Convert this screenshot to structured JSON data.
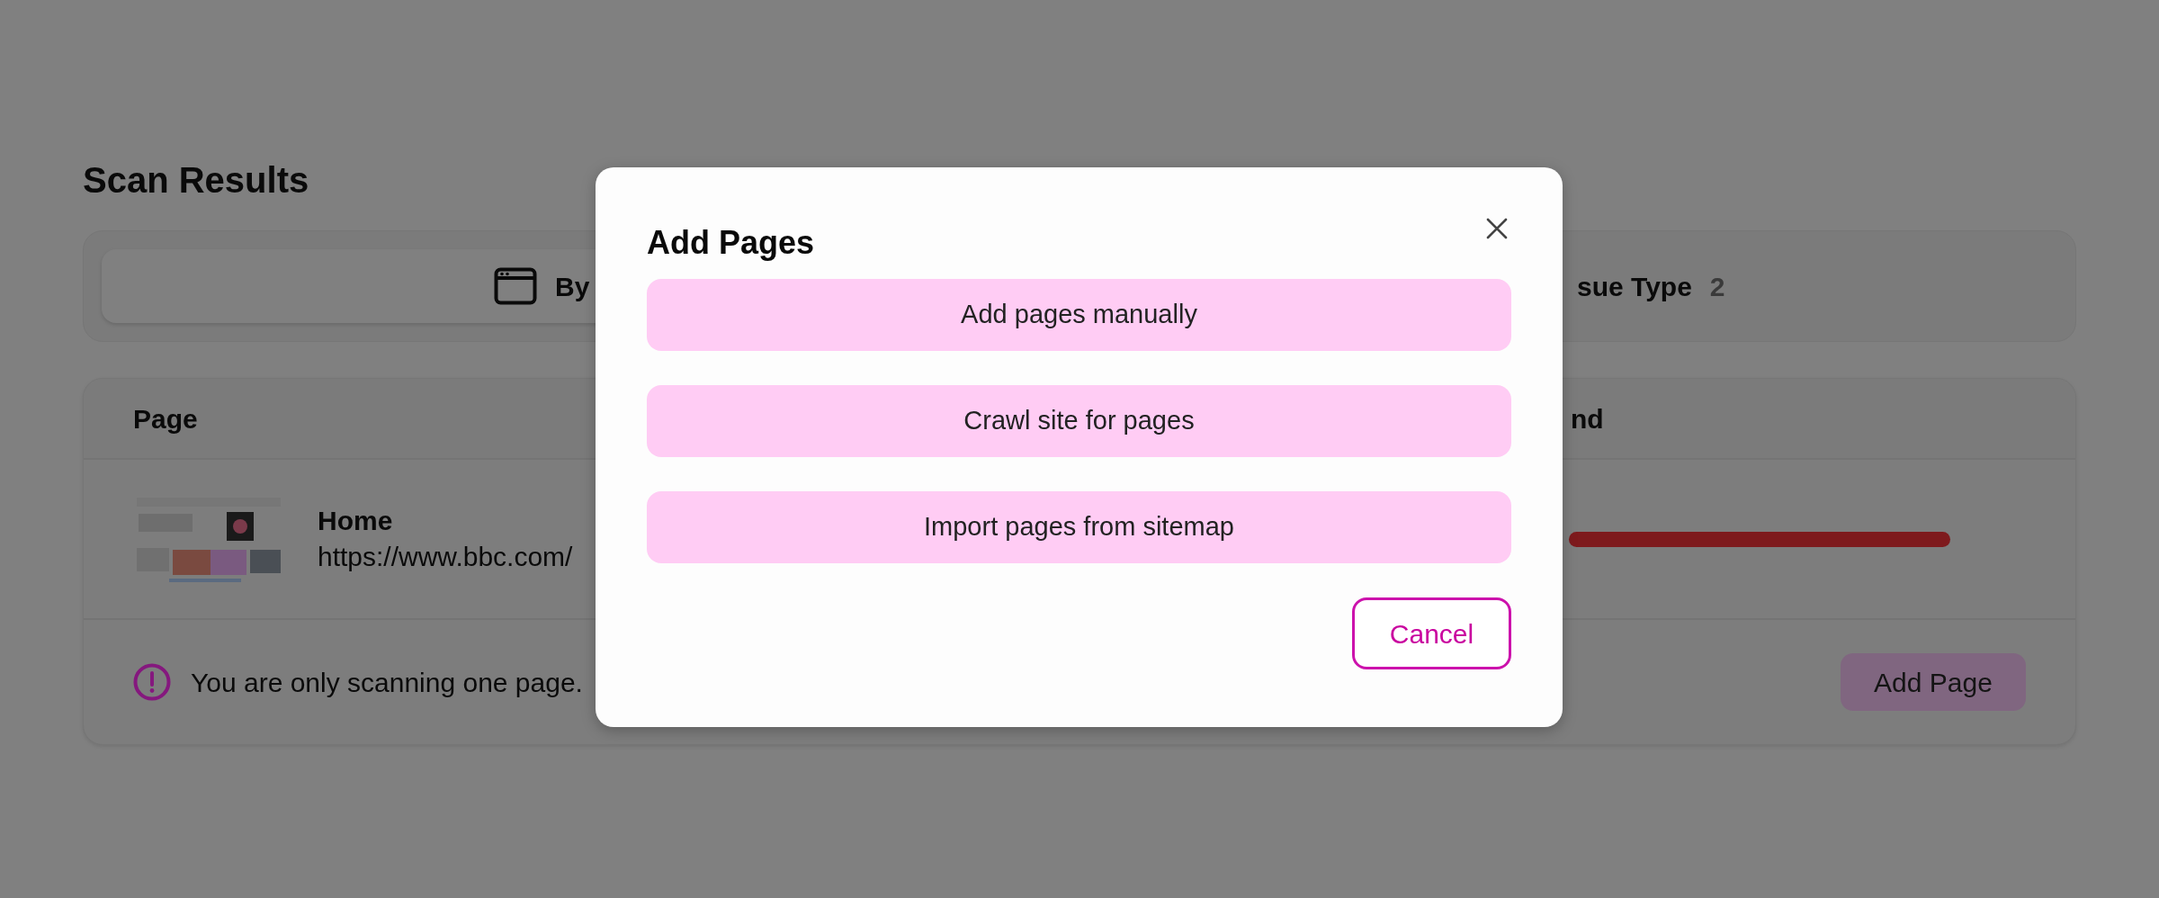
{
  "page": {
    "title": "Scan Results"
  },
  "tabs": [
    {
      "label": "By",
      "selected": true
    },
    {
      "label": "sue Type",
      "count": "2",
      "selected": false
    }
  ],
  "table": {
    "columns": [
      "Page",
      "nd"
    ],
    "rows": [
      {
        "name": "Home",
        "url": "https://www.bbc.com/"
      }
    ],
    "footer": {
      "message": "You are only scanning one page.",
      "button": "Add Page"
    }
  },
  "dialog": {
    "title": "Add Pages",
    "options": [
      "Add pages manually",
      "Crawl site for pages",
      "Import pages from sitemap"
    ],
    "cancel": "Cancel"
  }
}
